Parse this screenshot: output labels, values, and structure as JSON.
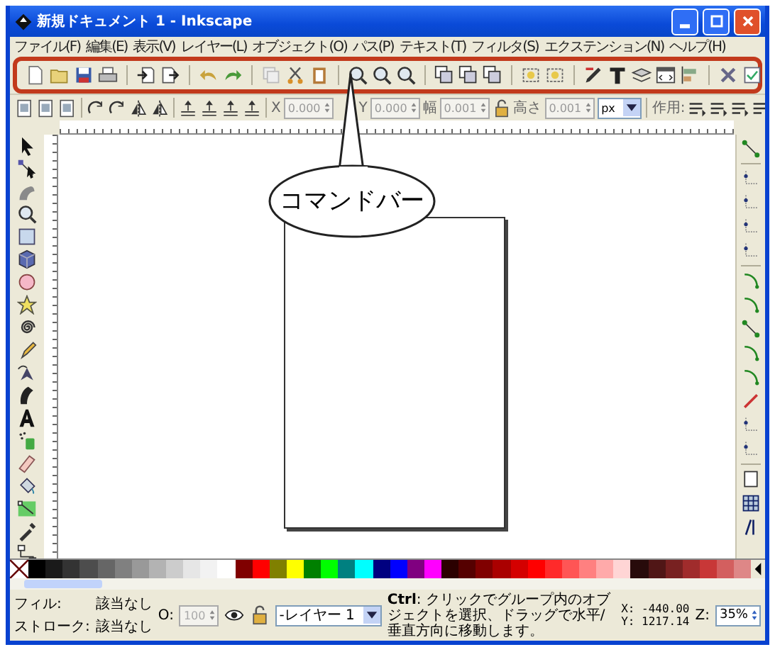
{
  "window": {
    "title": "新規ドキュメント 1 - Inkscape"
  },
  "menu": [
    "ファイル(F)",
    "編集(E)",
    "表示(V)",
    "レイヤー(L)",
    "オブジェクト(O)",
    "パス(P)",
    "テキスト(T)",
    "フィルタ(S)",
    "エクステンション(N)",
    "ヘルプ(H)"
  ],
  "tool_controls": {
    "fields": [
      {
        "label": "X",
        "value": "0.000"
      },
      {
        "label": "Y",
        "value": "0.000"
      },
      {
        "label": "幅",
        "value": "0.001"
      },
      {
        "label": "高さ",
        "value": "0.001"
      }
    ],
    "unit": "px",
    "affect_label": "作用:"
  },
  "callout": {
    "text": "コマンドバー"
  },
  "palette": [
    {
      "color": "#000000"
    },
    {
      "color": "#1a1a1a"
    },
    {
      "color": "#333333"
    },
    {
      "color": "#4d4d4d"
    },
    {
      "color": "#666666"
    },
    {
      "color": "#808080"
    },
    {
      "color": "#999999"
    },
    {
      "color": "#b3b3b3"
    },
    {
      "color": "#cccccc"
    },
    {
      "color": "#e6e6e6"
    },
    {
      "color": "#f2f2f2"
    },
    {
      "color": "#ffffff"
    },
    {
      "color": "#800000"
    },
    {
      "color": "#ff0000"
    },
    {
      "color": "#808000"
    },
    {
      "color": "#ffff00"
    },
    {
      "color": "#008000"
    },
    {
      "color": "#00ff00"
    },
    {
      "color": "#008080"
    },
    {
      "color": "#00ffff"
    },
    {
      "color": "#000080"
    },
    {
      "color": "#0000ff"
    },
    {
      "color": "#800080"
    },
    {
      "color": "#ff00ff"
    },
    {
      "color": "#2b0000"
    },
    {
      "color": "#550000"
    },
    {
      "color": "#800000"
    },
    {
      "color": "#aa0000"
    },
    {
      "color": "#d40000"
    },
    {
      "color": "#ff0000"
    },
    {
      "color": "#ff2a2a"
    },
    {
      "color": "#ff5555"
    },
    {
      "color": "#ff8080"
    },
    {
      "color": "#ffaaaa"
    },
    {
      "color": "#ffd5d5"
    },
    {
      "color": "#280b0b"
    },
    {
      "color": "#501616"
    },
    {
      "color": "#782121"
    },
    {
      "color": "#a02c2c"
    },
    {
      "color": "#c83737"
    },
    {
      "color": "#d35f5f"
    },
    {
      "color": "#de8787"
    }
  ],
  "status": {
    "fill_label": "フィル:",
    "fill": "該当なし",
    "stroke_label": "ストローク:",
    "stroke": "該当なし",
    "opacity_label": "O:",
    "opacity": "100",
    "layer": "-レイヤー 1",
    "message": "**Ctrl**: クリックでグループ内のオブジェクトを選択、ドラッグで水平/垂直方向に移動します。",
    "x": "X: -440.00",
    "y": "Y: 1217.14",
    "zoom_label": "Z:",
    "zoom": "35%"
  }
}
